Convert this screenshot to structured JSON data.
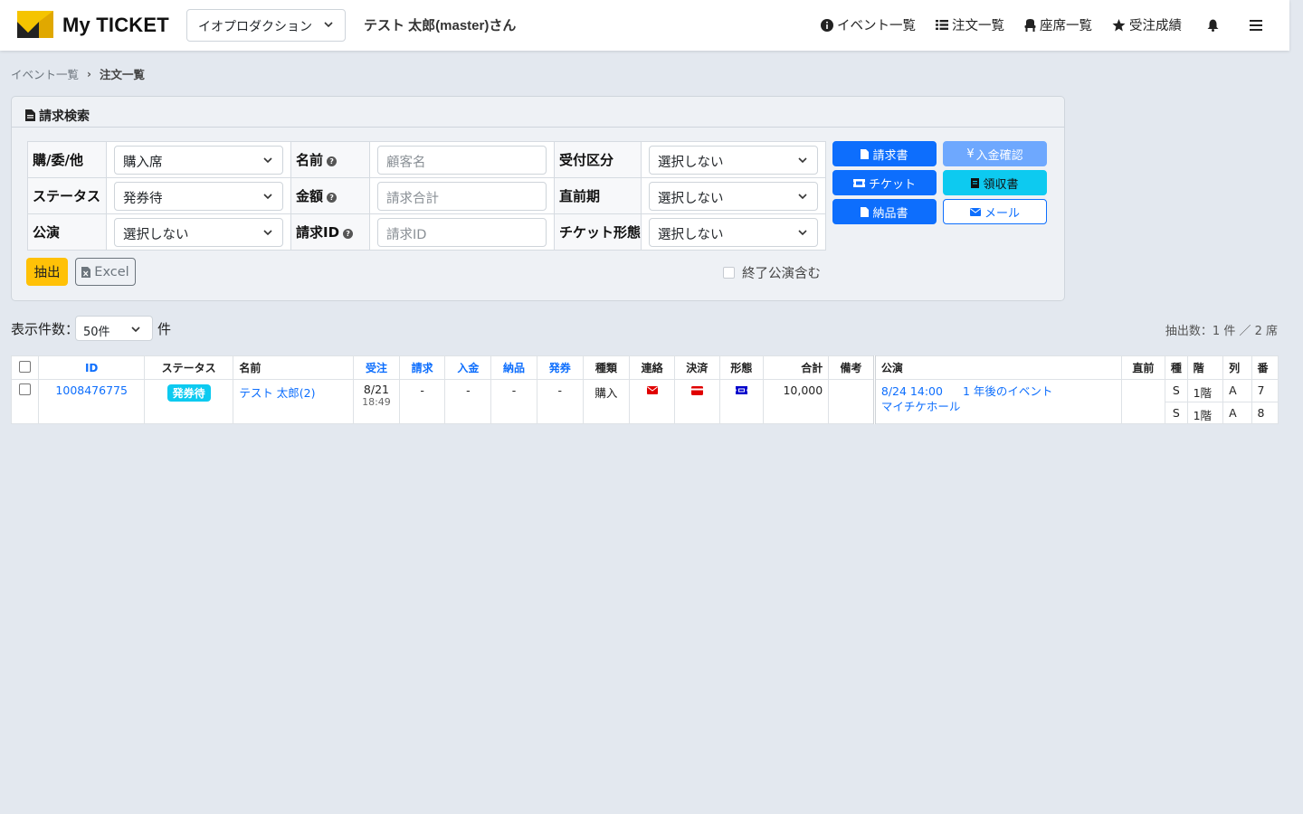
{
  "header": {
    "brand": "My TICKET",
    "org": "イオプロダクション",
    "user": "テスト 太郎(master)さん",
    "nav": {
      "events": "イベント一覧",
      "orders": "注文一覧",
      "seats": "座席一覧",
      "results": "受注成績"
    }
  },
  "breadcrumb": {
    "parent": "イベント一覧",
    "current": "注文一覧"
  },
  "search": {
    "title": "請求検索",
    "fields": {
      "kind_label": "購/委/他",
      "kind_value": "購入席",
      "name_label": "名前",
      "name_placeholder": "顧客名",
      "reception_label": "受付区分",
      "reception_value": "選択しない",
      "status_label": "ステータス",
      "status_value": "発券待",
      "amount_label": "金額",
      "amount_placeholder": "請求合計",
      "lastminute_label": "直前期",
      "lastminute_value": "選択しない",
      "performance_label": "公演",
      "performance_value": "選択しない",
      "invoice_id_label": "請求ID",
      "invoice_id_placeholder": "請求ID",
      "ticket_form_label": "チケット形態",
      "ticket_form_value": "選択しない"
    },
    "buttons": {
      "invoice": "請求書",
      "payment_confirm": "入金確認",
      "ticket": "チケット",
      "receipt": "領収書",
      "delivery": "納品書",
      "mail": "メール",
      "extract": "抽出",
      "excel": "Excel"
    },
    "include_ended": "終了公演含む"
  },
  "list": {
    "per_page_label": "表示件数：",
    "per_page_value": "50件",
    "per_page_unit": "件",
    "count": "抽出数：1 件 ／ 2 席",
    "columns": [
      "ID",
      "ステータス",
      "名前",
      "受注",
      "請求",
      "入金",
      "納品",
      "発券",
      "種類",
      "連絡",
      "決済",
      "形態",
      "合計",
      "備考",
      "公演",
      "直前",
      "種",
      "階",
      "列",
      "番"
    ],
    "rows": [
      {
        "id": "1008476775",
        "status": "発券待",
        "name": "テスト 太郎(2)",
        "order_date": "8/21",
        "order_time": "18:49",
        "invoice": "-",
        "payment": "-",
        "delivery": "-",
        "issue": "-",
        "type": "購入",
        "total": "10,000",
        "note": "",
        "perf_datetime": "8/24 14:00",
        "perf_title": "1 年後のイベント",
        "venue": "マイチケホール",
        "lastminute": "",
        "seats": [
          {
            "grade": "S",
            "floor": "1階",
            "row": "A",
            "number": "7"
          },
          {
            "grade": "S",
            "floor": "1階",
            "row": "A",
            "number": "8"
          }
        ]
      }
    ]
  },
  "colors": {
    "accent": "#0d6efd",
    "info": "#0dcaf0",
    "warning": "#ffc107",
    "mail_icon": "#e00000",
    "card_icon": "#e00000",
    "ticket_icon": "#0000cc",
    "logo_yellow": "#f5c400"
  }
}
